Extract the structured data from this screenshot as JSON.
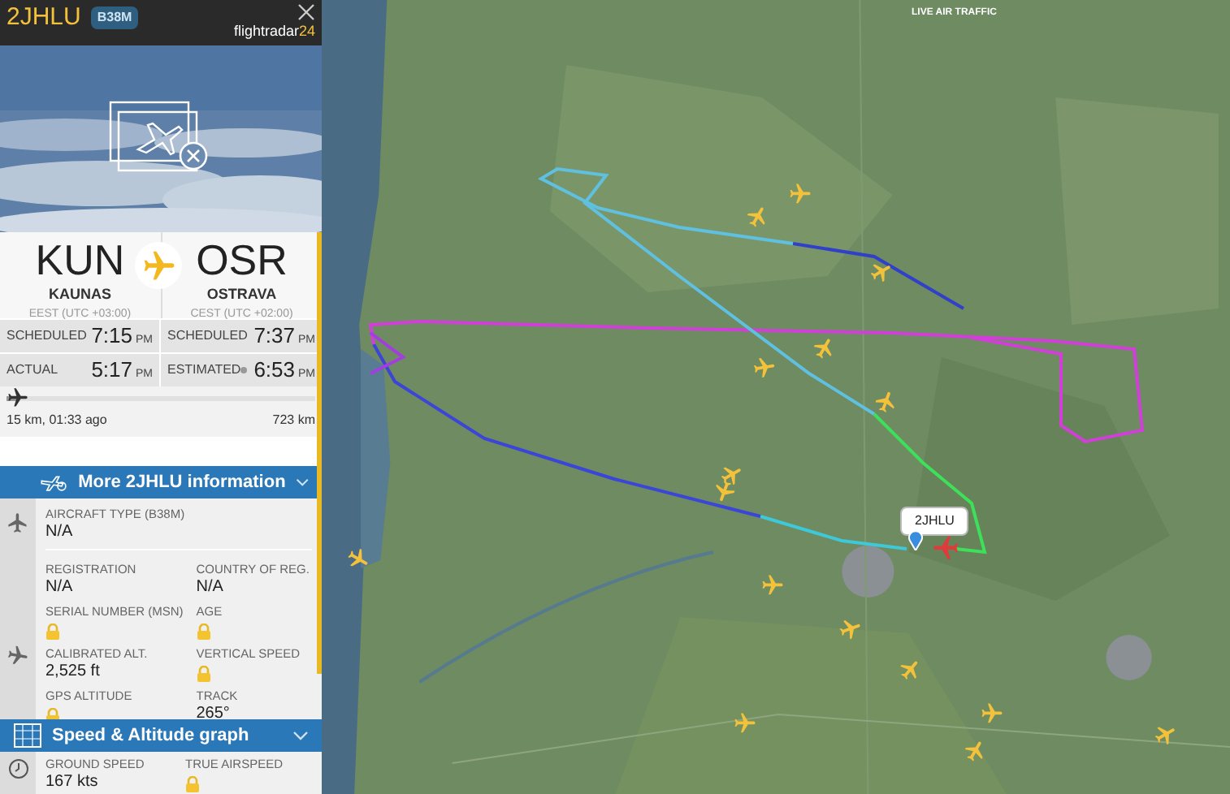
{
  "header": {
    "callsign": "2JHLU",
    "type_badge": "B38M",
    "logo_main": "flightradar",
    "logo_accent": "24"
  },
  "route": {
    "origin": {
      "code": "KUN",
      "city": "KAUNAS",
      "timezone": "EEST (UTC +03:00)"
    },
    "destination": {
      "code": "OSR",
      "city": "OSTRAVA",
      "timezone": "CEST (UTC +02:00)"
    }
  },
  "times": [
    {
      "label": "SCHEDULED",
      "time": "7:15",
      "suffix": "PM",
      "live": false
    },
    {
      "label": "SCHEDULED",
      "time": "7:37",
      "suffix": "PM",
      "live": false
    },
    {
      "label": "ACTUAL",
      "time": "5:17",
      "suffix": "PM",
      "live": false
    },
    {
      "label": "ESTIMATED",
      "time": "6:53",
      "suffix": "PM",
      "live": true
    }
  ],
  "progress": {
    "level": 0.03,
    "flown": "15 km, 01:33 ago",
    "remaining": "723 km"
  },
  "info_section": {
    "title": "More 2JHLU information",
    "expanded": true,
    "aircraft_type": {
      "label": "AIRCRAFT TYPE (B38M)",
      "value": "N/A"
    },
    "fields": [
      {
        "label": "REGISTRATION",
        "value": "N/A",
        "locked": false
      },
      {
        "label": "COUNTRY OF REG.",
        "value": "N/A",
        "locked": false
      },
      {
        "label": "SERIAL NUMBER (MSN)",
        "locked": true
      },
      {
        "label": "AGE",
        "locked": true
      },
      {
        "label": "CALIBRATED ALT.",
        "value": "2,525 ft",
        "locked": false
      },
      {
        "label": "VERTICAL SPEED",
        "locked": true
      },
      {
        "label": "GPS ALTITUDE",
        "locked": true
      },
      {
        "label": "TRACK",
        "value": "265°",
        "locked": false
      }
    ]
  },
  "speed_section": {
    "title": "Speed & Altitude graph",
    "expanded": true,
    "fields": [
      {
        "label": "GROUND SPEED",
        "value": "167 kts",
        "locked": false
      },
      {
        "label": "TRUE AIRSPEED",
        "locked": true
      }
    ]
  },
  "map": {
    "logo_subtitle": "LIVE AIR TRAFFIC",
    "selected_label": "2JHLU"
  }
}
